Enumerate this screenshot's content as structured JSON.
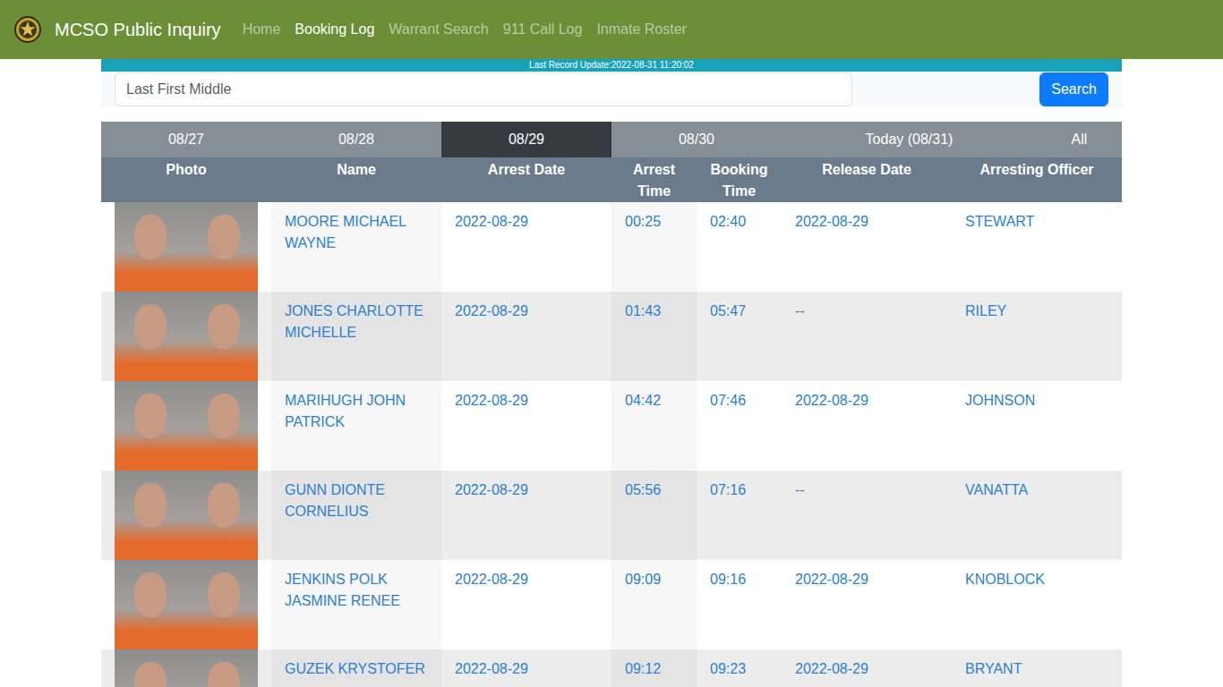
{
  "nav": {
    "brand": "MCSO Public Inquiry",
    "links": [
      {
        "label": "Home",
        "selected": false
      },
      {
        "label": "Booking Log",
        "selected": true
      },
      {
        "label": "Warrant Search",
        "selected": false
      },
      {
        "label": "911 Call Log",
        "selected": false
      },
      {
        "label": "Inmate Roster",
        "selected": false
      }
    ]
  },
  "update": "Last Record Update:2022-08-31 11:20:02",
  "search": {
    "placeholder": "Last First Middle",
    "button": "Search"
  },
  "date_tabs": [
    {
      "label": "08/27",
      "selected": false
    },
    {
      "label": "08/28",
      "selected": false
    },
    {
      "label": "08/29",
      "selected": true
    },
    {
      "label": "08/30",
      "selected": false
    },
    {
      "label": "Today (08/31)",
      "selected": false
    },
    {
      "label": "All",
      "selected": false
    }
  ],
  "table": {
    "columns": [
      "Photo",
      "Name",
      "Arrest Date",
      "Arrest Time",
      "Booking Time",
      "Release Date",
      "Arresting Officer"
    ],
    "rows": [
      [
        "MOORE MICHAEL WAYNE",
        "2022-08-29",
        "00:25",
        "02:40",
        "2022-08-29",
        "STEWART"
      ],
      [
        "JONES CHARLOTTE MICHELLE",
        "2022-08-29",
        "01:43",
        "05:47",
        "--",
        "RILEY"
      ],
      [
        "MARIHUGH JOHN PATRICK",
        "2022-08-29",
        "04:42",
        "07:46",
        "2022-08-29",
        "JOHNSON"
      ],
      [
        "GUNN DIONTE CORNELIUS",
        "2022-08-29",
        "05:56",
        "07:16",
        "--",
        "VANATTA"
      ],
      [
        "JENKINS POLK JASMINE RENEE",
        "2022-08-29",
        "09:09",
        "09:16",
        "2022-08-29",
        "KNOBLOCK"
      ],
      [
        "GUZEK KRYSTOFER",
        "2022-08-29",
        "09:12",
        "09:23",
        "2022-08-29",
        "BRYANT"
      ]
    ]
  }
}
